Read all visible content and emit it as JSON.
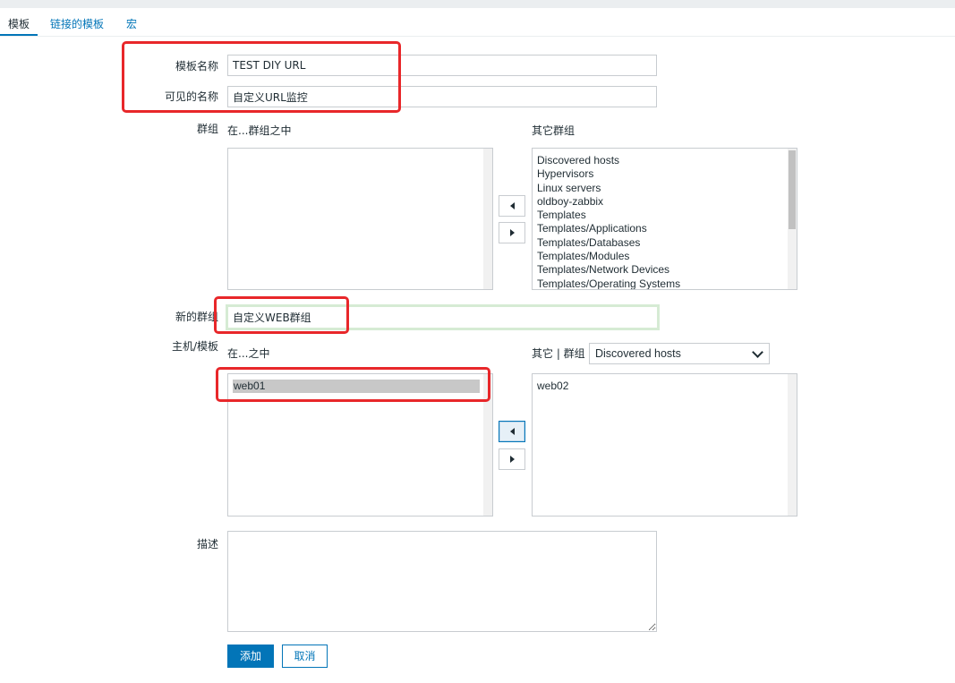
{
  "tabs": [
    {
      "label": "模板"
    },
    {
      "label": "链接的模板"
    },
    {
      "label": "宏"
    }
  ],
  "form": {
    "template_name": {
      "label": "模板名称",
      "value": "TEST DIY URL"
    },
    "visible_name": {
      "label": "可见的名称",
      "value": "自定义URL监控"
    },
    "groups": {
      "label": "群组",
      "in_label": "在...群组之中",
      "other_label": "其它群组",
      "other_items": [
        "Discovered hosts",
        "Hypervisors",
        "Linux servers",
        "oldboy-zabbix",
        "Templates",
        "Templates/Applications",
        "Templates/Databases",
        "Templates/Modules",
        "Templates/Network Devices",
        "Templates/Operating Systems"
      ]
    },
    "new_group": {
      "label": "新的群组",
      "value": "自定义WEB群组"
    },
    "hosts": {
      "label": "主机/模板",
      "in_label": "在...之中",
      "other_label": "其它 | 群组",
      "group_select": "Discovered hosts",
      "in_items": [
        "web01"
      ],
      "other_items": [
        "web02"
      ]
    },
    "description": {
      "label": "描述",
      "value": ""
    },
    "buttons": {
      "add": "添加",
      "cancel": "取消"
    }
  },
  "colors": {
    "accent": "#0275b8",
    "highlight": "#e8272a",
    "new_group_border": "#d6ebd4"
  }
}
